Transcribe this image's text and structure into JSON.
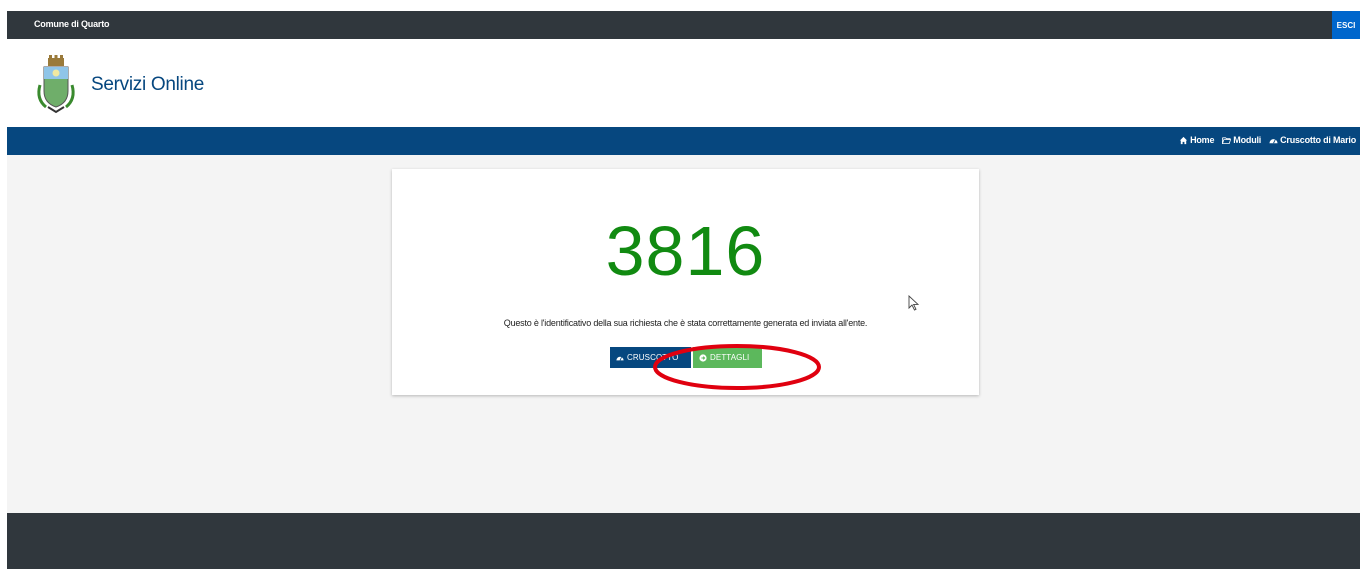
{
  "topbar": {
    "entity_name": "Comune di Quarto",
    "logout_label": "ESCI"
  },
  "header": {
    "logo_icon": "municipal-coat-of-arms",
    "site_title": "Servizi Online"
  },
  "nav": {
    "items": [
      {
        "label": "Home",
        "icon": "home-icon"
      },
      {
        "label": "Moduli",
        "icon": "folder-open-icon"
      },
      {
        "label": "Cruscotto di Mario",
        "icon": "dashboard-icon"
      }
    ]
  },
  "result": {
    "request_id": "3816",
    "message": "Questo è l'identificativo della sua richiesta che è stata correttamente generata ed inviata all'ente.",
    "buttons": {
      "dashboard_label": "CRUSCOTTO",
      "details_label": "DETTAGLI"
    }
  },
  "colors": {
    "topbar": "#30373d",
    "primary_blue": "#06477f",
    "logout_blue": "#0066cc",
    "id_green": "#118a11",
    "details_green": "#5cb85c",
    "annotation_red": "#e0000f"
  }
}
